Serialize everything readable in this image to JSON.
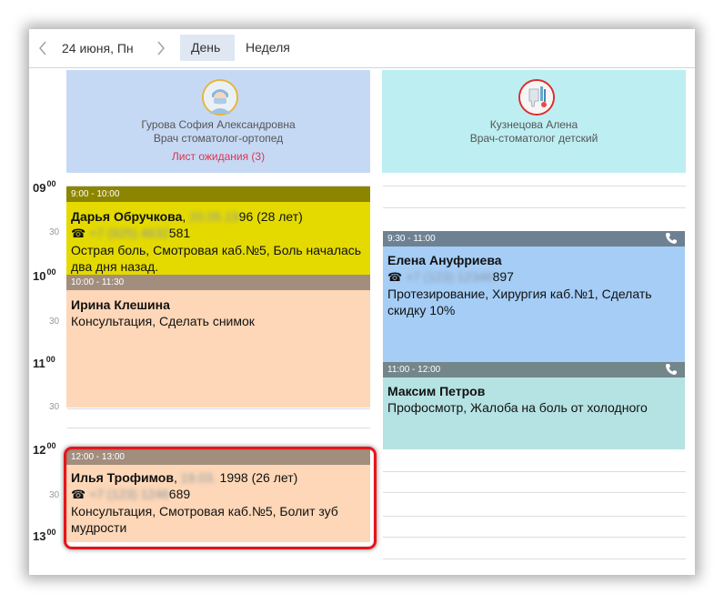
{
  "toolbar": {
    "date": "24 июня, Пн",
    "tabs": [
      {
        "label": "День",
        "active": true
      },
      {
        "label": "Неделя",
        "active": false
      }
    ],
    "prev_icon": "chevron-left-icon",
    "next_icon": "chevron-right-icon"
  },
  "timeline": {
    "hours": [
      {
        "hour": "09",
        "minutes": "00"
      },
      {
        "hour": "10",
        "minutes": "00"
      },
      {
        "hour": "11",
        "minutes": "00"
      },
      {
        "hour": "12",
        "minutes": "00"
      },
      {
        "hour": "13",
        "minutes": "00"
      }
    ],
    "half": "30"
  },
  "doctors": [
    {
      "name": "Гурова София Александровна",
      "specialty": "Врач стоматолог-ортопед",
      "waitlist": "Лист ожидания (3)",
      "header_color": "#c6d9f4",
      "appointments": [
        {
          "time": "9:00 - 10:00",
          "patient": "Дарья Обручкова",
          "dob_hidden": "20.05.19",
          "dob_visible": "96 (28 лет)",
          "phone_hidden": "+7 (925) 4632",
          "phone_visible": "581",
          "note": "Острая боль, Смотровая каб.№5, Боль началась два дня назад.",
          "head_color": "#8c8500",
          "body_color": "#e4da00"
        },
        {
          "time": "10:00 - 11:30",
          "patient": "Ирина Клешина",
          "note": "Консультация, Сделать снимок",
          "head_color": "#a38e7e",
          "body_color": "#fdd7b7"
        },
        {
          "time": "12:00 - 13:00",
          "patient": "Илья Трофимов",
          "dob_hidden": "19.03.",
          "dob_visible": "1998 (26 лет)",
          "phone_hidden": "+7 (123) 1246",
          "phone_visible": "689",
          "note": "Консультация, Смотровая каб.№5, Болит зуб мудрости",
          "head_color": "#a38e7e",
          "body_color": "#fdd7b7"
        }
      ]
    },
    {
      "name": "Кузнецова Алена",
      "specialty": "Врач-стоматолог детский",
      "header_color": "#bdeef2",
      "appointments": [
        {
          "time": "9:30 - 11:00",
          "patient": "Елена Ануфриева",
          "phone_hidden": "+7 (123) 12346",
          "phone_visible": "897",
          "note": "Протезирование, Хирургия каб.№1, Сделать скидку 10%",
          "head_color": "#6e8193",
          "body_color": "#a5cdf6",
          "call_icon": "phone-icon"
        },
        {
          "time": "11:00 - 12:00",
          "patient": "Максим Петров",
          "note": "Профосмотр, Жалоба на боль от холодного",
          "head_color": "#73868a",
          "body_color": "#b5e2e2",
          "call_icon": "phone-icon"
        }
      ]
    }
  ]
}
